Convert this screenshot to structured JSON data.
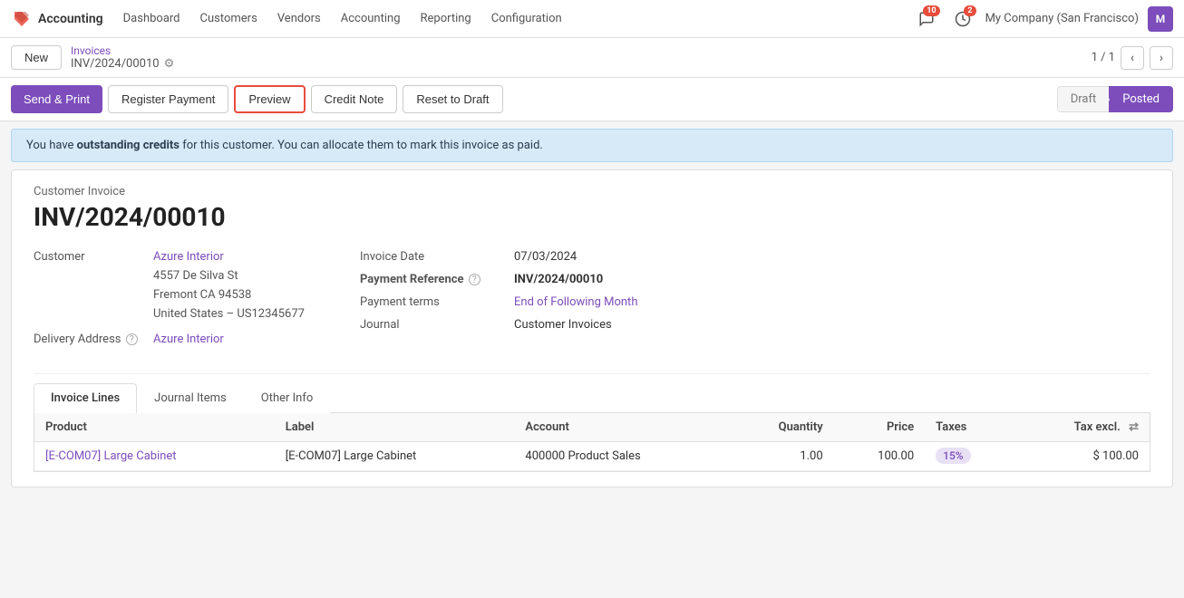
{
  "app": {
    "logo_text": "✕",
    "brand": "Accounting"
  },
  "topnav": {
    "items": [
      {
        "id": "dashboard",
        "label": "Dashboard"
      },
      {
        "id": "customers",
        "label": "Customers"
      },
      {
        "id": "vendors",
        "label": "Vendors"
      },
      {
        "id": "accounting",
        "label": "Accounting"
      },
      {
        "id": "reporting",
        "label": "Reporting"
      },
      {
        "id": "configuration",
        "label": "Configuration"
      }
    ],
    "notifications": {
      "count": "10"
    },
    "clock": {
      "count": "2"
    },
    "company": "My Company (San Francisco)",
    "avatar_initials": "M"
  },
  "breadcrumb": {
    "new_label": "New",
    "parent": "Invoices",
    "current": "INV/2024/00010",
    "pagination": "1 / 1"
  },
  "actions": {
    "send_print": "Send & Print",
    "register_payment": "Register Payment",
    "preview": "Preview",
    "credit_note": "Credit Note",
    "reset_draft": "Reset to Draft",
    "status_draft": "Draft",
    "status_posted": "Posted"
  },
  "alert": {
    "text_before": "You have ",
    "bold": "outstanding credits",
    "text_after": " for this customer. You can allocate them to mark this invoice as paid."
  },
  "invoice": {
    "type": "Customer Invoice",
    "number": "INV/2024/00010",
    "customer_label": "Customer",
    "customer_name": "Azure Interior",
    "customer_address": "4557 De Silva St\nFremont CA 94538\nUnited States – US12345677",
    "delivery_label": "Delivery Address",
    "delivery_help": "?",
    "delivery_value": "Azure Interior",
    "invoice_date_label": "Invoice Date",
    "invoice_date": "07/03/2024",
    "payment_ref_label": "Payment Reference",
    "payment_ref_help": "?",
    "payment_ref": "INV/2024/00010",
    "payment_terms_label": "Payment terms",
    "payment_terms": "End of Following Month",
    "journal_label": "Journal",
    "journal": "Customer Invoices"
  },
  "tabs": [
    {
      "id": "invoice-lines",
      "label": "Invoice Lines",
      "active": true
    },
    {
      "id": "journal-items",
      "label": "Journal Items",
      "active": false
    },
    {
      "id": "other-info",
      "label": "Other Info",
      "active": false
    }
  ],
  "table": {
    "columns": [
      {
        "id": "product",
        "label": "Product"
      },
      {
        "id": "label",
        "label": "Label"
      },
      {
        "id": "account",
        "label": "Account"
      },
      {
        "id": "quantity",
        "label": "Quantity"
      },
      {
        "id": "price",
        "label": "Price"
      },
      {
        "id": "taxes",
        "label": "Taxes"
      },
      {
        "id": "tax_excl",
        "label": "Tax excl."
      }
    ],
    "rows": [
      {
        "product": "[E-COM07] Large Cabinet",
        "label": "[E-COM07] Large Cabinet",
        "account": "400000 Product Sales",
        "quantity": "1.00",
        "price": "100.00",
        "taxes": "15%",
        "tax_excl": "$ 100.00"
      }
    ]
  }
}
